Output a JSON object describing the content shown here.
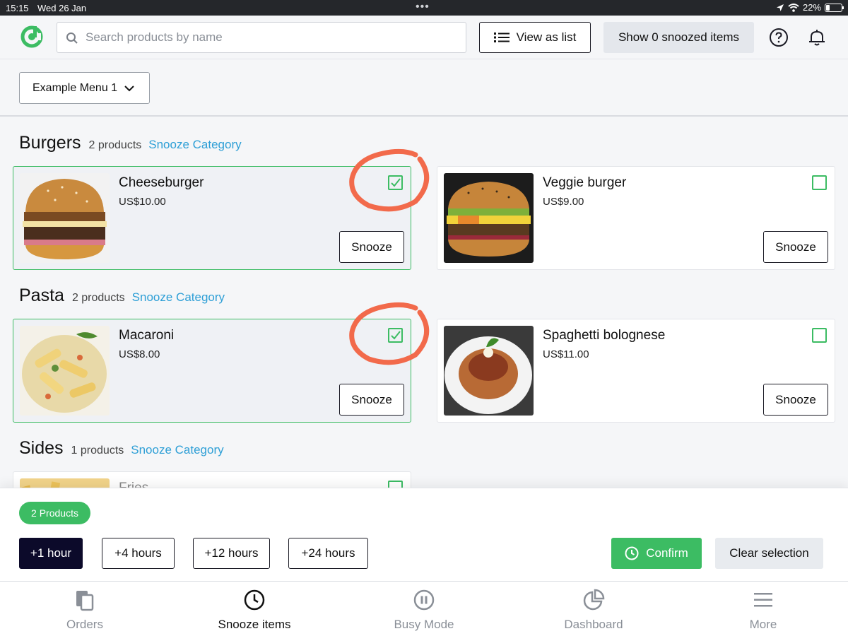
{
  "status_bar": {
    "time": "15:15",
    "date": "Wed 26 Jan",
    "battery": "22%"
  },
  "header": {
    "search_placeholder": "Search products by name",
    "view_list_label": "View as list",
    "snoozed_label": "Show 0 snoozed items"
  },
  "menu": {
    "selected": "Example Menu 1"
  },
  "categories": [
    {
      "title": "Burgers",
      "count": "2 products",
      "snooze_label": "Snooze Category",
      "products": [
        {
          "name": "Cheeseburger",
          "price": "US$10.00",
          "selected": true,
          "snooze_label": "Snooze"
        },
        {
          "name": "Veggie burger",
          "price": "US$9.00",
          "selected": false,
          "snooze_label": "Snooze"
        }
      ]
    },
    {
      "title": "Pasta",
      "count": "2 products",
      "snooze_label": "Snooze Category",
      "products": [
        {
          "name": "Macaroni",
          "price": "US$8.00",
          "selected": true,
          "snooze_label": "Snooze"
        },
        {
          "name": "Spaghetti bolognese",
          "price": "US$11.00",
          "selected": false,
          "snooze_label": "Snooze"
        }
      ]
    },
    {
      "title": "Sides",
      "count": "1 products",
      "snooze_label": "Snooze Category",
      "products": [
        {
          "name": "Fries",
          "price": "",
          "selected": false
        }
      ]
    }
  ],
  "action_panel": {
    "selected_badge": "2 Products",
    "durations": [
      "+1 hour",
      "+4 hours",
      "+12 hours",
      "+24 hours"
    ],
    "active_duration": "+1 hour",
    "confirm_label": "Confirm",
    "clear_label": "Clear selection"
  },
  "tabs": [
    {
      "label": "Orders",
      "icon": "orders-icon",
      "active": false
    },
    {
      "label": "Snooze items",
      "icon": "clock-icon",
      "active": true
    },
    {
      "label": "Busy Mode",
      "icon": "pause-icon",
      "active": false
    },
    {
      "label": "Dashboard",
      "icon": "pie-chart-icon",
      "active": false
    },
    {
      "label": "More",
      "icon": "hamburger-menu-icon",
      "active": false
    }
  ],
  "colors": {
    "accent_green": "#3cbc63",
    "link_blue": "#2e9fd6",
    "dark_navy": "#0c0a2a",
    "annotation_orange": "#f26a4b"
  }
}
